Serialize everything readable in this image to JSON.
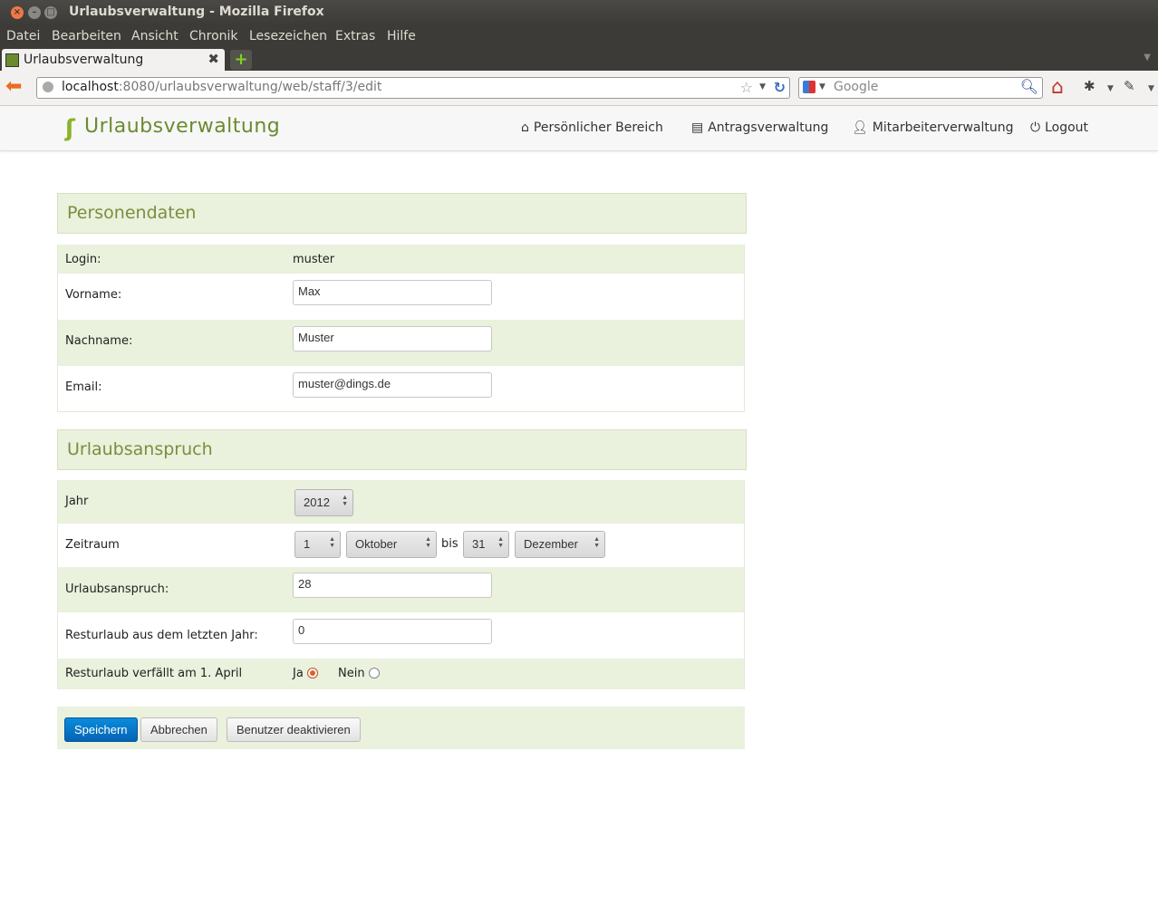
{
  "window": {
    "title": "Urlaubsverwaltung - Mozilla Firefox"
  },
  "menu": [
    "Datei",
    "Bearbeiten",
    "Ansicht",
    "Chronik",
    "Lesezeichen",
    "Extras",
    "Hilfe"
  ],
  "tab": {
    "label": "Urlaubsverwaltung"
  },
  "url": {
    "host": "localhost",
    "rest": ":8080/urlaubsverwaltung/web/staff/3/edit"
  },
  "search": {
    "placeholder": "Google"
  },
  "header": {
    "brand": "Urlaubsverwaltung",
    "nav": [
      "Persönlicher Bereich",
      "Antragsverwaltung",
      "Mitarbeiterverwaltung",
      "Logout"
    ]
  },
  "personal": {
    "title": "Personendaten",
    "login_label": "Login:",
    "login_value": "muster",
    "firstname_label": "Vorname:",
    "firstname_value": "Max",
    "lastname_label": "Nachname:",
    "lastname_value": "Muster",
    "email_label": "Email:",
    "email_value": "muster@dings.de"
  },
  "vacation": {
    "title": "Urlaubsanspruch",
    "year_label": "Jahr",
    "year_value": "2012",
    "period_label": "Zeitraum",
    "from_day": "1",
    "from_month": "Oktober",
    "bis": "bis",
    "to_day": "31",
    "to_month": "Dezember",
    "entitlement_label": "Urlaubsanspruch:",
    "entitlement_value": "28",
    "remaining_label": "Resturlaub aus dem letzten Jahr:",
    "remaining_value": "0",
    "expires_label": "Resturlaub verfällt am 1. April",
    "yes_label": "Ja",
    "no_label": "Nein",
    "selected": "Ja"
  },
  "actions": {
    "save": "Speichern",
    "cancel": "Abbrechen",
    "deactivate": "Benutzer deaktivieren"
  }
}
